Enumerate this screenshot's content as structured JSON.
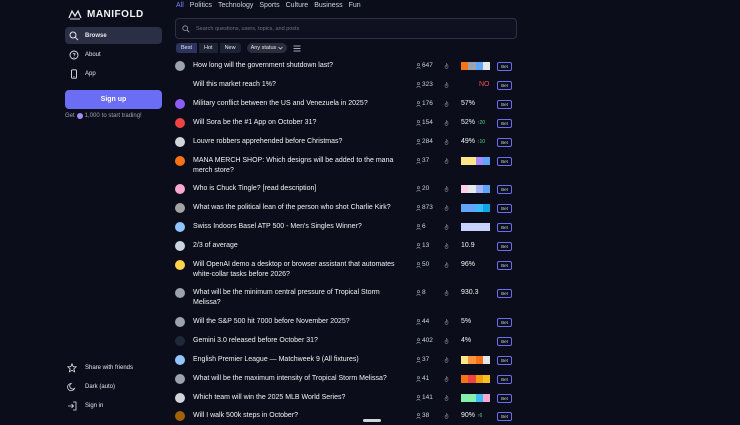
{
  "brand": {
    "name": "MANIFOLD"
  },
  "sidebar": {
    "nav": [
      {
        "label": "Browse",
        "icon": "search-icon",
        "active": true
      },
      {
        "label": "About",
        "icon": "help-circle-icon",
        "active": false
      },
      {
        "label": "App",
        "icon": "phone-icon",
        "active": false
      }
    ],
    "signup_label": "Sign up",
    "bonus_prefix": "Get",
    "bonus_amount": "1,000",
    "bonus_suffix": "to start trading!",
    "bottom": [
      {
        "label": "Share with friends",
        "icon": "star-icon"
      },
      {
        "label": "Dark (auto)",
        "icon": "moon-icon"
      },
      {
        "label": "Sign in",
        "icon": "login-icon"
      }
    ]
  },
  "topics": [
    "All",
    "Politics",
    "Technology",
    "Sports",
    "Culture",
    "Business",
    "Fun"
  ],
  "search": {
    "placeholder": "Search questions, users, topics, and posts"
  },
  "sorts": [
    "Best",
    "Hot",
    "New"
  ],
  "status_filter": "Any status",
  "bet_label": "Bet",
  "colors": {
    "accent": "#6b6ef4",
    "no": "#f05252",
    "up": "#4ade80"
  },
  "markets": [
    {
      "question": "How long will the government shutdown last?",
      "traders": "647",
      "prob": "",
      "delta": "",
      "bar": [
        "#f97316",
        "#9ca3af",
        "#60a5fa",
        "#e5e7eb"
      ],
      "avatar": "#9ca3af"
    },
    {
      "question": "Will this market reach 1%?",
      "traders": "323",
      "prob": "NO",
      "delta": "",
      "bar": [],
      "avatar": ""
    },
    {
      "question": "Military conflict between the US and Venezuela in 2025?",
      "traders": "176",
      "prob": "57%",
      "delta": "",
      "bar": [],
      "avatar": "#8b5cf6"
    },
    {
      "question": "Will Sora be the #1 App on October 31?",
      "traders": "154",
      "prob": "52%",
      "delta": "20",
      "bar": [],
      "avatar": "#ef4444"
    },
    {
      "question": "Louvre robbers apprehended before Christmas?",
      "traders": "284",
      "prob": "49%",
      "delta": "10",
      "bar": [],
      "avatar": "#d1d5db"
    },
    {
      "question": "MANA MERCH SHOP: Which designs will be added to the mana merch store?",
      "traders": "37",
      "prob": "",
      "delta": "",
      "bar": [
        "#fde68a",
        "#fde68a",
        "#a78bfa",
        "#60a5fa"
      ],
      "avatar": "#f97316"
    },
    {
      "question": "Who is Chuck Tingle? [read description]",
      "traders": "20",
      "prob": "",
      "delta": "",
      "bar": [
        "#fbcfe8",
        "#e5e7eb",
        "#a5b4fc",
        "#60a5fa"
      ],
      "avatar": "#f9a8d4"
    },
    {
      "question": "What was the political lean of the person who shot Charlie Kirk?",
      "traders": "873",
      "prob": "",
      "delta": "",
      "bar": [
        "#60a5fa",
        "#60a5fa",
        "#38bdf8",
        "#0ea5e9"
      ],
      "avatar": "#a3a3a3"
    },
    {
      "question": "Swiss Indoors Basel ATP 500 - Men's Singles Winner?",
      "traders": "6",
      "prob": "",
      "delta": "",
      "bar": [
        "#c7d2fe",
        "#c7d2fe",
        "#c7d2fe",
        "#c7d2fe"
      ],
      "avatar": "#93c5fd"
    },
    {
      "question": "2/3 of average",
      "traders": "13",
      "prob": "10.9",
      "delta": "",
      "bar": [],
      "avatar": "#cbd5e1"
    },
    {
      "question": "Will OpenAI demo a desktop or browser assistant that automates white-collar tasks before 2026?",
      "traders": "50",
      "prob": "96%",
      "delta": "",
      "bar": [],
      "avatar": "#fcd34d"
    },
    {
      "question": "What will be the minimum central pressure of Tropical Storm Melissa?",
      "traders": "8",
      "prob": "930.3",
      "delta": "",
      "bar": [],
      "avatar": "#9ca3af"
    },
    {
      "question": "Will the S&P 500 hit 7000 before November 2025?",
      "traders": "44",
      "prob": "5%",
      "delta": "",
      "bar": [],
      "avatar": "#9ca3af"
    },
    {
      "question": "Gemini 3.0 released before October 31?",
      "traders": "402",
      "prob": "4%",
      "delta": "",
      "bar": [],
      "avatar": "#1f2937"
    },
    {
      "question": "English Premier League — Matchweek 9 (All fixtures)",
      "traders": "37",
      "prob": "",
      "delta": "",
      "bar": [
        "#fde68a",
        "#fb923c",
        "#f97316",
        "#e5e7eb"
      ],
      "avatar": "#93c5fd"
    },
    {
      "question": "What will be the maximum intensity of Tropical Storm Melissa?",
      "traders": "41",
      "prob": "",
      "delta": "",
      "bar": [
        "#f97316",
        "#ef4444",
        "#f59e0b",
        "#fbbf24"
      ],
      "avatar": "#9ca3af"
    },
    {
      "question": "Which team will win the 2025 MLB World Series?",
      "traders": "141",
      "prob": "",
      "delta": "",
      "bar": [
        "#86efac",
        "#86efac",
        "#38bdf8",
        "#f9a8d4"
      ],
      "avatar": "#d1d5db"
    },
    {
      "question": "Will I walk 500k steps in October?",
      "traders": "38",
      "prob": "90%",
      "delta": "6",
      "bar": [],
      "avatar": "#a16207"
    }
  ]
}
